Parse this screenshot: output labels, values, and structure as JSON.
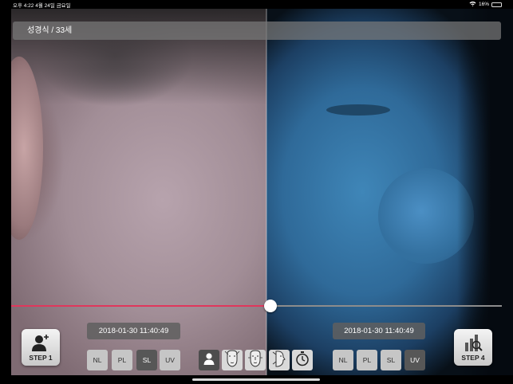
{
  "status_bar": {
    "time_date": "오후 4:22   4월 24일 금요일",
    "battery": "16%",
    "battery_level": 0.16
  },
  "header": {
    "patient": "성경식 / 33세"
  },
  "comparison": {
    "slider_position": 0.5,
    "left": {
      "timestamp": "2018-01-30 11:40:49",
      "modes": [
        "NL",
        "PL",
        "SL",
        "UV"
      ],
      "active_mode": "SL"
    },
    "right": {
      "timestamp": "2018-01-30 11:40:49",
      "modes": [
        "NL",
        "PL",
        "SL",
        "UV"
      ],
      "active_mode": "UV"
    }
  },
  "toolbar": {
    "step1_label": "STEP 1",
    "step4_label": "STEP 4",
    "tools": [
      "profile-icon",
      "face-front-icon",
      "face-front-alt-icon",
      "face-side-icon",
      "timer-icon"
    ]
  },
  "colors": {
    "slider_active": "#e0375c",
    "button_active": "#575757",
    "button_inactive": "#c6c6c6"
  }
}
